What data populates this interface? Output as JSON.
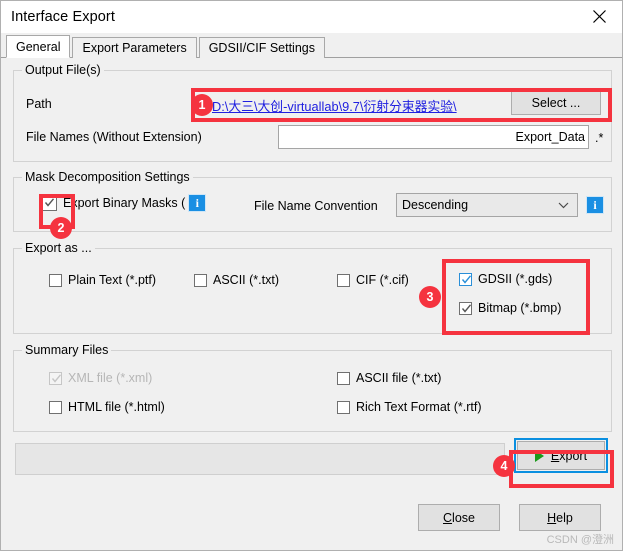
{
  "window": {
    "title": "Interface Export",
    "close_icon": "close-icon"
  },
  "tabs": [
    {
      "label": "General",
      "active": true
    },
    {
      "label": "Export Parameters",
      "active": false
    },
    {
      "label": "GDSII/CIF Settings",
      "active": false
    }
  ],
  "output_files": {
    "group_label": "Output File(s)",
    "path_label": "Path",
    "path_value": "D:\\大三\\大创-virtuallab\\9.7\\衍射分束器实验\\",
    "select_button": "Select ...",
    "file_names_label": "File Names (Without Extension)",
    "file_names_value": "Export_Data",
    "file_names_placeholder": "Export_Data",
    "extension_suffix": ".*"
  },
  "mask_decomposition": {
    "group_label": "Mask Decomposition Settings",
    "export_binary_masks_label": "Export Binary Masks (",
    "export_binary_masks_checked": true,
    "info_icon": "info-icon",
    "file_name_convention_label": "File Name Convention",
    "file_name_convention_value": "Descending",
    "file_name_convention_options": [
      "Descending"
    ],
    "convention_info_icon": "info-icon"
  },
  "export_as": {
    "group_label": "Export as ...",
    "options": [
      {
        "label": "Plain Text (*.ptf)",
        "checked": false,
        "focus": false
      },
      {
        "label": "ASCII (*.txt)",
        "checked": false,
        "focus": false
      },
      {
        "label": "CIF (*.cif)",
        "checked": false,
        "focus": false
      },
      {
        "label": "GDSII (*.gds)",
        "checked": true,
        "focus": true
      },
      {
        "label": "Bitmap (*.bmp)",
        "checked": true,
        "focus": false
      }
    ]
  },
  "summary_files": {
    "group_label": "Summary Files",
    "options": [
      {
        "label": "XML file (*.xml)",
        "checked": true,
        "disabled": true
      },
      {
        "label": "ASCII file (*.txt)",
        "checked": false,
        "disabled": false
      },
      {
        "label": "HTML file (*.html)",
        "checked": false,
        "disabled": false
      },
      {
        "label": "Rich Text Format (*.rtf)",
        "checked": false,
        "disabled": false
      }
    ]
  },
  "footer": {
    "export_button": "Export",
    "export_accel": "E",
    "export_rest": "xport",
    "play_icon": "play-triangle-icon",
    "close_button_accel": "C",
    "close_button_rest": "lose",
    "close_button": "Close",
    "help_button_accel": "H",
    "help_button_rest": "elp",
    "help_button": "Help",
    "progress_value": ""
  },
  "annotations": {
    "accent_color": "#f5333f",
    "badges": [
      {
        "number": "1"
      },
      {
        "number": "2"
      },
      {
        "number": "3"
      },
      {
        "number": "4"
      }
    ]
  },
  "watermark": {
    "text": "CSDN @澄洲"
  }
}
